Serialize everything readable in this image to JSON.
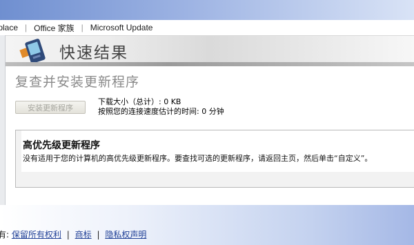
{
  "nav": {
    "items": [
      "tplace",
      "Office 家族",
      "Microsoft Update"
    ]
  },
  "banner": {
    "title": "快速结果",
    "icon": "pda-device-icon"
  },
  "page": {
    "title": "复查并安装更新程序"
  },
  "install": {
    "button_label": "安装更新程序",
    "download_size": "下载大小（总计）: 0 KB",
    "estimated_time": "按照您的连接速度估计的时间: 0 分钟"
  },
  "priority": {
    "title": "高优先级更新程序",
    "message": "没有适用于您的计算机的高优先级更新程序。要查找可选的更新程序，请返回主页，然后单击“自定义”。"
  },
  "footer": {
    "prefix": "有:",
    "links": [
      "保留所有权利",
      "商标",
      "隐私权声明"
    ]
  },
  "colors": {
    "link": "#1f3f96",
    "top_band": "#6f8fd0",
    "bottom_band": "#a5b8e6"
  }
}
